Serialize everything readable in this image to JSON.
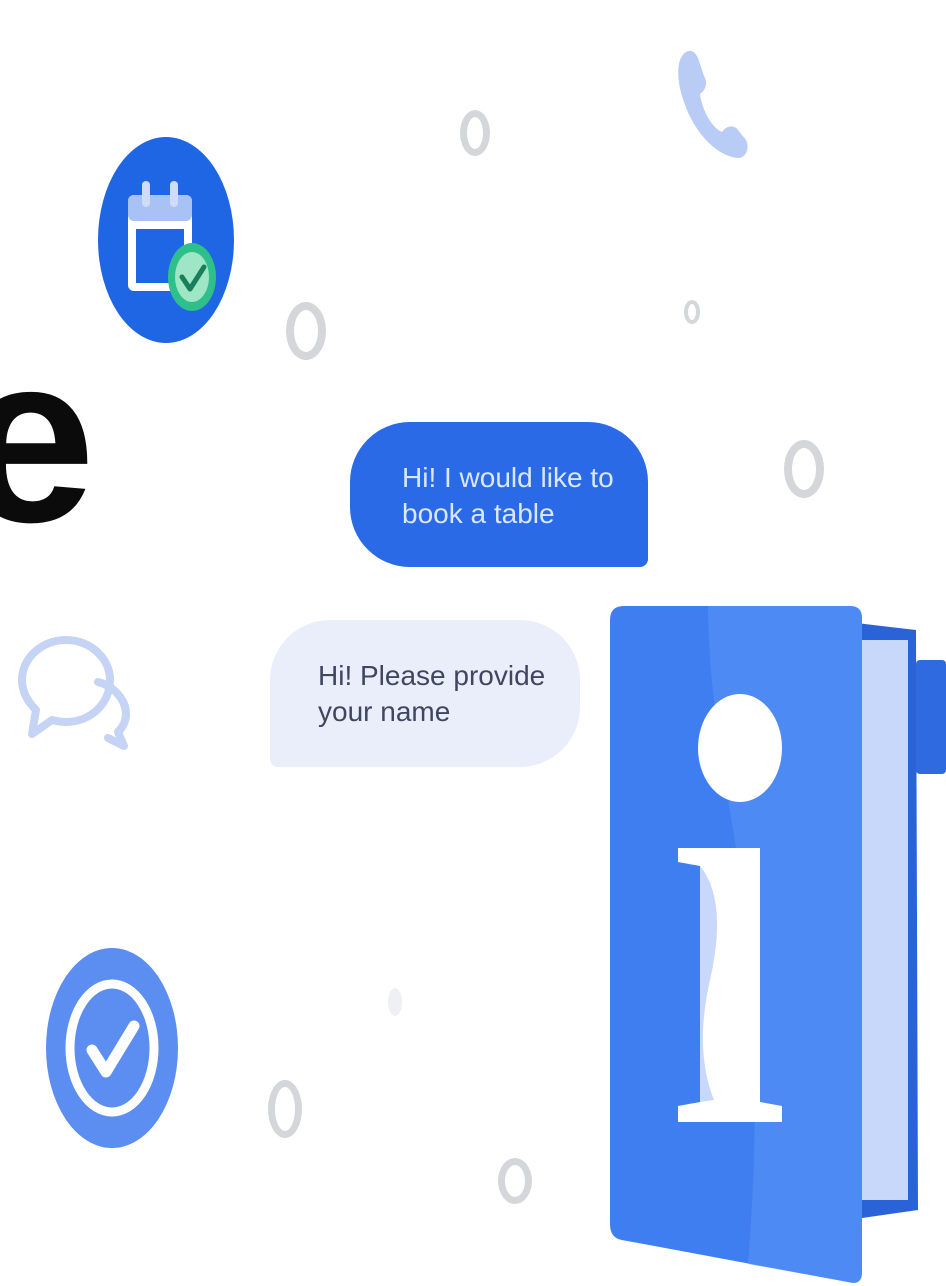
{
  "heading": {
    "visible_fragment": "e"
  },
  "chat": {
    "outgoing_message_lines": [
      "Hi! I would like to",
      "book a table"
    ],
    "incoming_message_lines": [
      "Hi! Please provide",
      "your name"
    ]
  },
  "icons": {
    "top_left": "calendar-check-icon",
    "top_right": "phone-icon",
    "left": "chat-bubbles-icon",
    "bottom_left": "check-circle-icon",
    "bottom_right": "info-document-icon"
  },
  "colors": {
    "primary_blue": "#1f66e5",
    "outgoing_bubble": "#2a6ae6",
    "incoming_bubble": "#eaeefb",
    "light_blue": "#b9ccf6",
    "soft_blue": "#5b8ef0"
  }
}
